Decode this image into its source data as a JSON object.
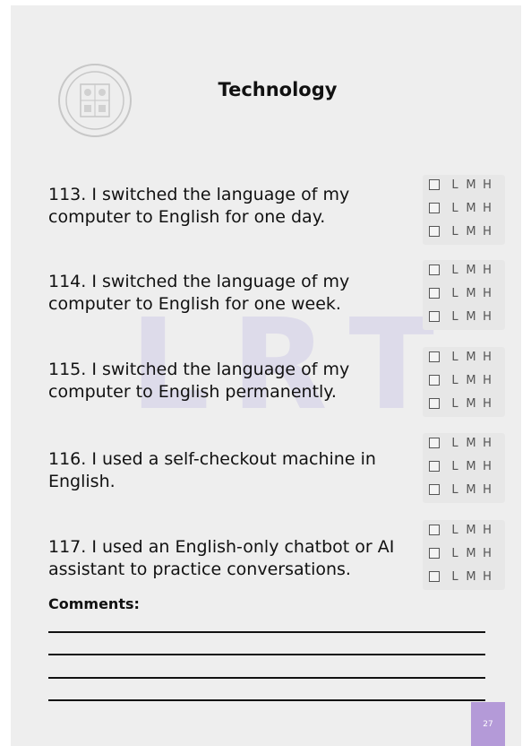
{
  "title": "Technology",
  "watermark": [
    "L",
    "R",
    "T"
  ],
  "level_labels": [
    "L",
    "M",
    "H"
  ],
  "questions": [
    {
      "text": "113. I switched the language of my computer to English for one day."
    },
    {
      "text": "114. I switched the language of my computer to English for one week."
    },
    {
      "text": "115. I switched the language of my computer to English permanently."
    },
    {
      "text": "116. I used a self-checkout machine in English."
    },
    {
      "text": "117. I used an English-only chatbot or AI assistant to practice conversations."
    }
  ],
  "comments_label": "Comments:",
  "page_number": "27",
  "colors": {
    "accent": "#b49ad8",
    "watermark": "#7c6fd6"
  }
}
